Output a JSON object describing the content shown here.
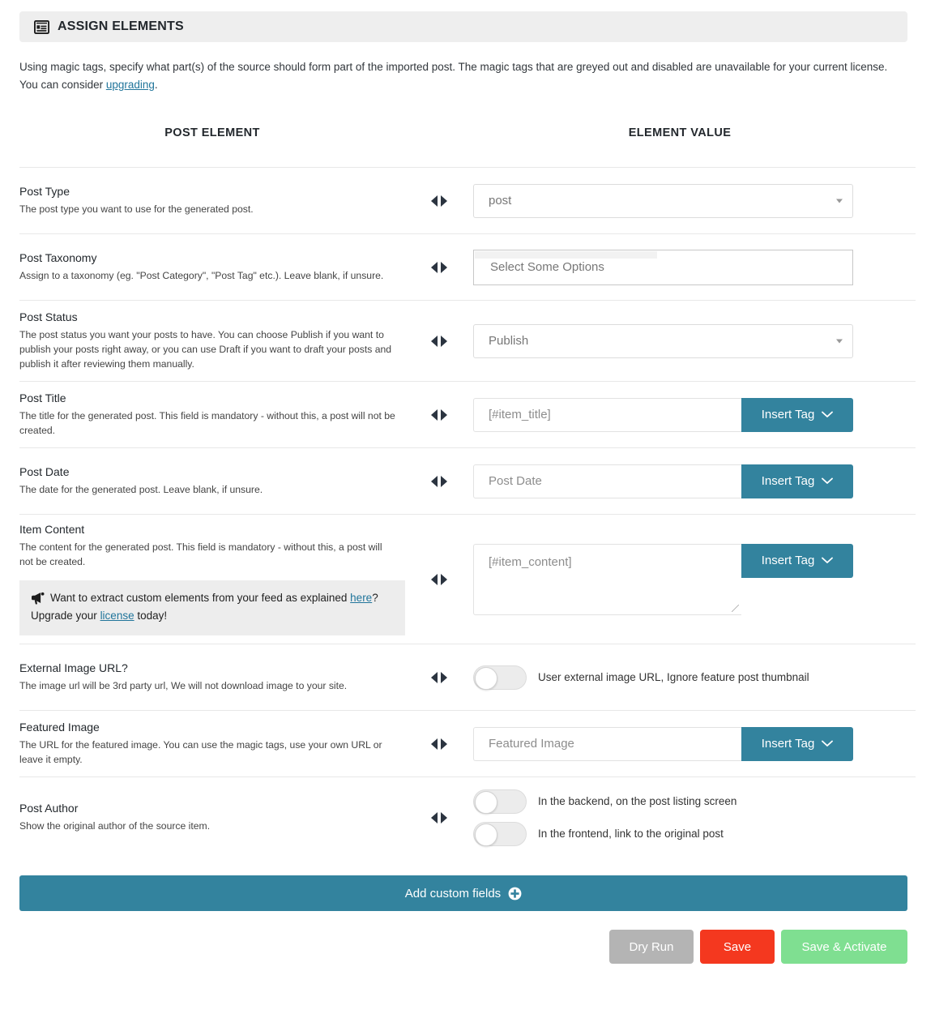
{
  "panel": {
    "title": "ASSIGN ELEMENTS",
    "icon": "list-box-icon",
    "intro_part1": "Using magic tags, specify what part(s) of the source should form part of the imported post. The magic tags that are greyed out and disabled are unavailable for your current license. You can consider ",
    "intro_link": "upgrading",
    "intro_part2": "."
  },
  "columns": {
    "left": "POST ELEMENT",
    "middle": "",
    "right": "ELEMENT VALUE"
  },
  "rows": {
    "post_type": {
      "label": "Post Type",
      "desc": "The post type you want to use for the generated post.",
      "select_value": "post"
    },
    "post_taxonomy": {
      "label": "Post Taxonomy",
      "desc": "Assign to a taxonomy (eg. \"Post Category\", \"Post Tag\" etc.). Leave blank, if unsure.",
      "placeholder": "Select Some Options"
    },
    "post_status": {
      "label": "Post Status",
      "desc": "The post status you want your posts to have. You can choose Publish if you want to publish your posts right away, or you can use Draft if you want to draft your posts and publish it after reviewing them manually.",
      "select_value": "Publish"
    },
    "post_title": {
      "label": "Post Title",
      "desc": "The title for the generated post. This field is mandatory - without this, a post will not be created.",
      "value": "[#item_title]",
      "button": "Insert Tag"
    },
    "post_date": {
      "label": "Post Date",
      "desc": "The date for the generated post. Leave blank, if unsure.",
      "value": "Post Date",
      "button": "Insert Tag"
    },
    "item_content": {
      "label": "Item Content",
      "desc": "The content for the generated post. This field is mandatory - without this, a post will not be created.",
      "value": "[#item_content]",
      "button": "Insert Tag",
      "notice_part1": "Want to extract custom elements from your feed as explained ",
      "notice_link1": "here",
      "notice_part2": "? Upgrade your ",
      "notice_link2": "license",
      "notice_part3": " today!"
    },
    "external_image_url": {
      "label": "External Image URL?",
      "desc": "The image url will be 3rd party url, We will not download image to your site.",
      "toggle_text": "User external image URL, Ignore feature post thumbnail",
      "toggle_state": "off"
    },
    "featured_image": {
      "label": "Featured Image",
      "desc": "The URL for the featured image. You can use the magic tags, use your own URL or leave it empty.",
      "value": "Featured Image",
      "button": "Insert Tag"
    },
    "post_author": {
      "label": "Post Author",
      "desc": "Show the original author of the source item.",
      "toggle1_text": "In the backend, on the post listing screen",
      "toggle1_state": "off",
      "toggle2_text": "In the frontend, link to the original post",
      "toggle2_state": "off"
    }
  },
  "footer": {
    "add_custom_fields": "Add custom fields",
    "dry_run": "Dry Run",
    "save": "Save",
    "save_activate": "Save & Activate"
  },
  "colors": {
    "teal": "#33839e",
    "red": "#f4381f",
    "green": "#7fdf91",
    "grey": "#b4b4b4",
    "link": "#21759b",
    "header_bg": "#eeeeee",
    "notice_bg": "#ededed"
  }
}
